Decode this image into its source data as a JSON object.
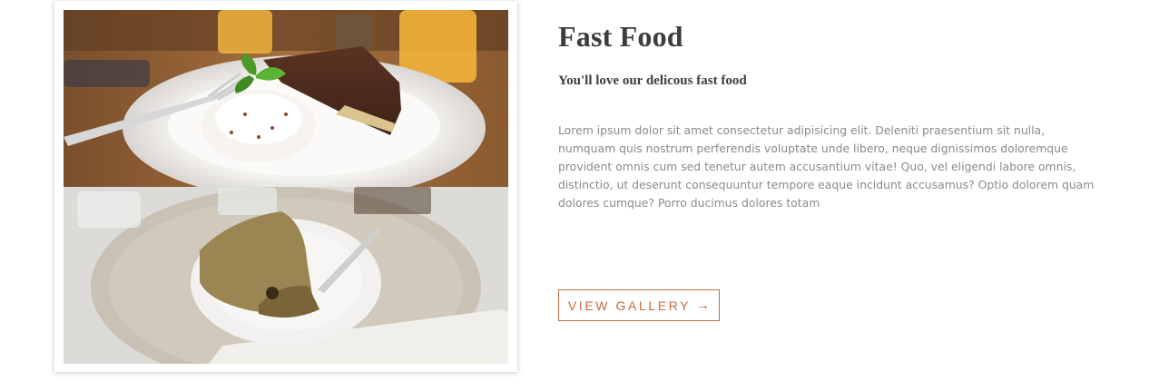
{
  "section": {
    "title": "Fast Food",
    "subtitle": "You'll love our delicous fast food",
    "body": "Lorem ipsum dolor sit amet consectetur adipisicing elit. Deleniti praesentium sit nulla, numquam quis nostrum perferendis voluptate unde libero, neque dignissimos doloremque provident omnis cum sed tenetur autem accusantium vitae! Quo, vel eligendi labore omnis, distinctio, ut deserunt consequuntur tempore eaque incidunt accusamus? Optio dolorem quam dolores cumque? Porro ducimus dolores totam",
    "button_label": "VIEW GALLERY",
    "button_arrow": "→"
  },
  "colors": {
    "accent": "#c8693f",
    "heading": "#3d3d3d",
    "body_text": "#8a8a8a"
  },
  "images": {
    "top_photo": "cake-slice-with-cream-photo",
    "bottom_photo": "sponge-cake-on-placemat-photo"
  }
}
